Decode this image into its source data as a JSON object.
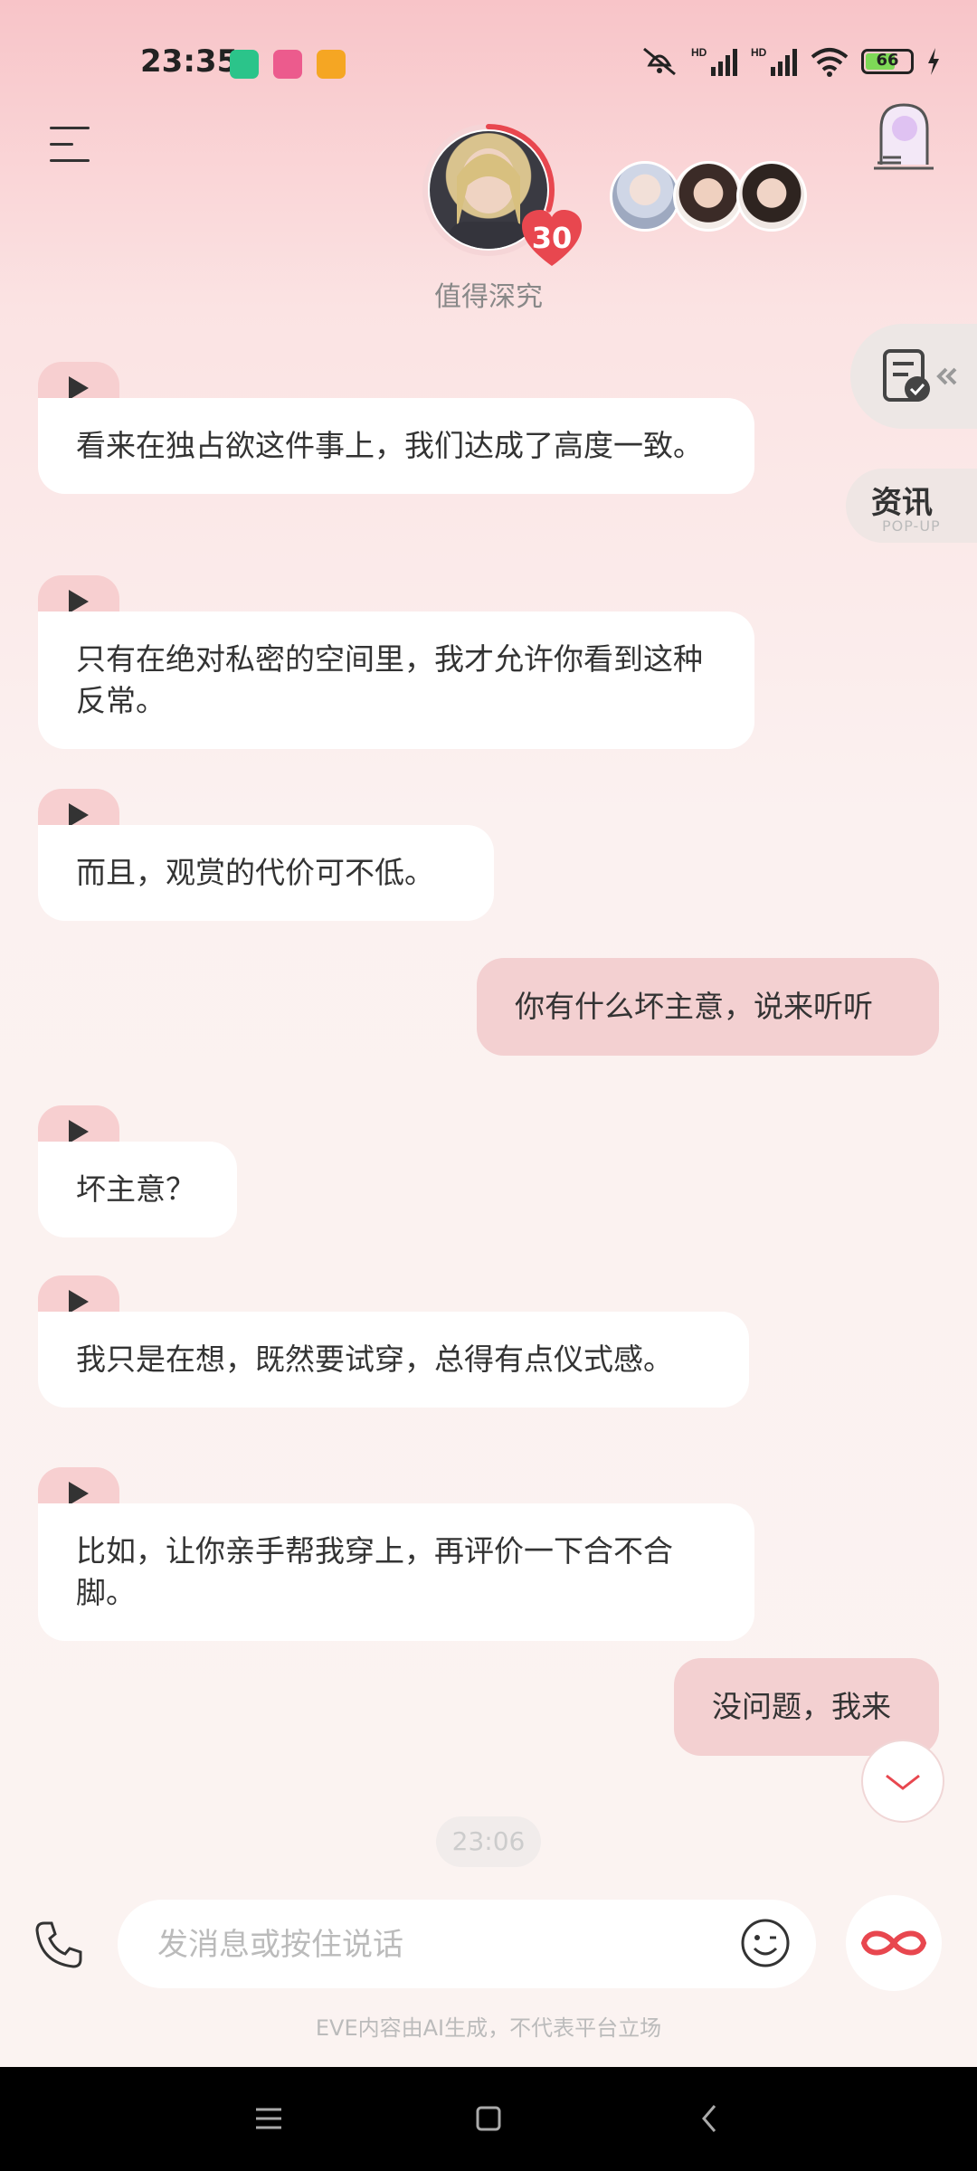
{
  "status_bar": {
    "time": "23:35",
    "battery": "66",
    "battery_level": 0.66,
    "icons": [
      "app-green-icon",
      "app-pink-icon",
      "app-orange-icon",
      "mute-icon",
      "signal-hd-icon",
      "signal-hd-icon",
      "wifi-icon",
      "battery-icon",
      "charging-icon"
    ]
  },
  "header": {
    "character_name": "值得深究",
    "level": "30",
    "level_progress": 0.3
  },
  "side": {
    "news_title": "资讯",
    "news_sub": "POP-UP"
  },
  "messages": [
    {
      "from": "ai",
      "text": "看来在独占欲这件事上，我们达成了高度一致。"
    },
    {
      "from": "ai",
      "text": "只有在绝对私密的空间里，我才允许你看到这种反常。"
    },
    {
      "from": "ai",
      "text": "而且，观赏的代价可不低。"
    },
    {
      "from": "user",
      "text": "你有什么坏主意，说来听听"
    },
    {
      "from": "ai",
      "text": "坏主意？"
    },
    {
      "from": "ai",
      "text": "我只是在想，既然要试穿，总得有点仪式感。"
    },
    {
      "from": "ai",
      "text": "比如，让你亲手帮我穿上，再评价一下合不合脚。"
    },
    {
      "from": "user",
      "text": "没问题，我来"
    }
  ],
  "timestamp": "23:06",
  "input": {
    "placeholder": "发消息或按住说话"
  },
  "disclaimer": "EVE内容由AI生成，不代表平台立场",
  "colors": {
    "accent": "#e8474f",
    "user_bubble": "#f3d0d1",
    "play_tab": "#f7cfd0"
  }
}
